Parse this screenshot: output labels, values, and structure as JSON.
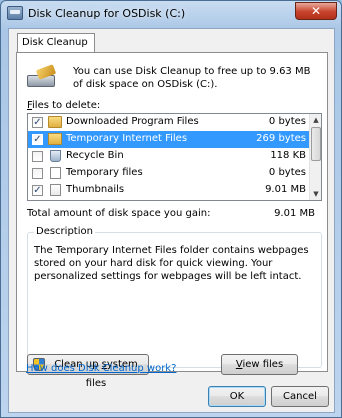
{
  "window": {
    "title": "Disk Cleanup for OSDisk (C:)",
    "close_label": "✕"
  },
  "tab": {
    "label": "Disk Cleanup"
  },
  "intro_text": "You can use Disk Cleanup to free up to 9.63 MB of disk space on OSDisk (C:).",
  "files_label": {
    "prefix": "",
    "accel": "F",
    "rest": "iles to delete:"
  },
  "files": [
    {
      "name": "Downloaded Program Files",
      "size": "0 bytes",
      "checked": true,
      "selected": false,
      "icon": "folder-icon"
    },
    {
      "name": "Temporary Internet Files",
      "size": "269 bytes",
      "checked": true,
      "selected": true,
      "icon": "lock-folder-icon"
    },
    {
      "name": "Recycle Bin",
      "size": "118 KB",
      "checked": false,
      "selected": false,
      "icon": "recycle-bin-icon"
    },
    {
      "name": "Temporary files",
      "size": "0 bytes",
      "checked": false,
      "selected": false,
      "icon": "file-icon"
    },
    {
      "name": "Thumbnails",
      "size": "9.01 MB",
      "checked": true,
      "selected": false,
      "icon": "thumbnail-icon"
    }
  ],
  "total": {
    "label": "Total amount of disk space you gain:",
    "value": "9.01 MB"
  },
  "description": {
    "title": "Description",
    "text": "The Temporary Internet Files folder contains webpages stored on your hard disk for quick viewing. Your personalized settings for webpages will be left intact."
  },
  "buttons": {
    "cleanup_system": {
      "pre": "Clean up ",
      "accel": "s",
      "post": "ystem files"
    },
    "view_files": {
      "pre": "",
      "accel": "V",
      "post": "iew files"
    },
    "ok": "OK",
    "cancel": "Cancel"
  },
  "help_link": "How does Disk Cleanup work?"
}
